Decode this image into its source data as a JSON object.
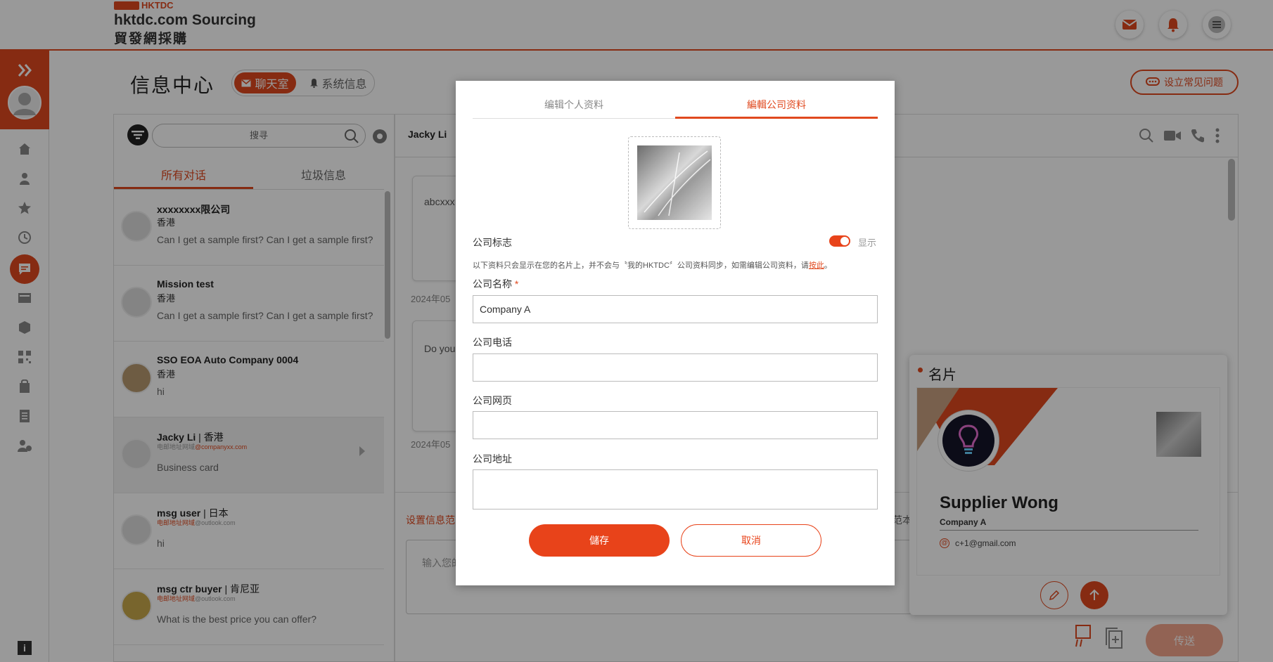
{
  "logo": {
    "tag": "HKTDC",
    "line1": "hktdc.com Sourcing",
    "line2": "貿發網採購"
  },
  "page": {
    "title": "信息中心"
  },
  "header_tabs": {
    "chat": "聊天室",
    "system": "系统信息"
  },
  "faq_button": "设立常见问题",
  "search": {
    "placeholder": "搜寻"
  },
  "list_tabs": {
    "all": "所有对话",
    "spam": "垃圾信息"
  },
  "conversations": [
    {
      "name": "xxxxxxxx限公司",
      "location": "香港",
      "email_prefix": "",
      "email_domain": "",
      "message": "Can I get a sample first? Can I get a sample first?"
    },
    {
      "name": "Mission test",
      "location": "香港",
      "email_prefix": "",
      "email_domain": "",
      "message": "Can I get a sample first? Can I get a sample first?"
    },
    {
      "name": "SSO EOA Auto Company 0004",
      "location": "香港",
      "email_prefix": "",
      "email_domain": "",
      "message": "hi"
    },
    {
      "name": "Jacky Li",
      "location": "香港",
      "email_prefix": "电邮地址网域",
      "email_domain": "@companyxx.com",
      "message": "Business card"
    },
    {
      "name": "msg user",
      "location": "日本",
      "email_prefix": "电邮地址网域",
      "email_domain": "@outlook.com",
      "message": "hi"
    },
    {
      "name": "msg ctr buyer",
      "location": "肯尼亚",
      "email_prefix": "电邮地址网域",
      "email_domain": "@outlook.com",
      "message": "What is the best price you can offer?"
    }
  ],
  "chat": {
    "contact": "Jacky Li",
    "bubble1": "abcxxx",
    "bubble2": "Do you",
    "date1": "2024年05",
    "date2": "2024年05",
    "settings_link": "设置信息范",
    "range_link": "范本",
    "input_placeholder": "输入您的",
    "send": "传送"
  },
  "business_card": {
    "title": "名片",
    "name": "Supplier Wong",
    "company": "Company A",
    "email": "c+1@gmail.com"
  },
  "modal": {
    "tab_personal": "编辑个人资料",
    "tab_company": "編輯公司资料",
    "logo_label": "公司标志",
    "toggle_label": "显示",
    "toggle_on": true,
    "note_text": "以下资料只会显示在您的名片上，并不会与〝我的HKTDC〞公司资料同步，如需编辑公司资料，请",
    "note_link": "按此",
    "note_end": "。",
    "company_name_label": "公司名称",
    "required_mark": "*",
    "company_name_value": "Company A",
    "phone_label": "公司电话",
    "phone_value": "",
    "website_label": "公司网页",
    "website_value": "",
    "address_label": "公司地址",
    "address_value": "",
    "save_button": "儲存",
    "cancel_button": "取消"
  },
  "colors": {
    "brand": "#e0491f",
    "save": "#e8431a"
  }
}
